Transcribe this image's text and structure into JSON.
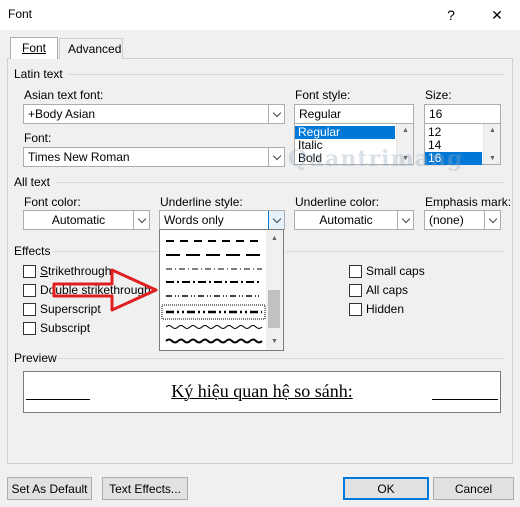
{
  "window": {
    "title": "Font",
    "help": "?",
    "close": "✕"
  },
  "tabs": [
    {
      "label": "Font",
      "active": true
    },
    {
      "label": "Advanced",
      "active": false
    }
  ],
  "latin": {
    "group_label": "Latin text",
    "asian_font_label": "Asian text font:",
    "asian_font_value": "+Body Asian",
    "font_label": "Font:",
    "font_value": "Times New Roman",
    "style_label": "Font style:",
    "style_value": "Regular",
    "style_options": [
      "Regular",
      "Italic",
      "Bold"
    ],
    "style_selected": "Regular",
    "size_label": "Size:",
    "size_value": "16",
    "size_options": [
      "12",
      "14",
      "16"
    ],
    "size_selected": "16"
  },
  "all_text": {
    "group_label": "All text",
    "color_label": "Font color:",
    "color_value": "Automatic",
    "underline_style_label": "Underline style:",
    "underline_style_value": "Words only",
    "underline_color_label": "Underline color:",
    "underline_color_value": "Automatic",
    "emphasis_label": "Emphasis mark:",
    "emphasis_value": "(none)"
  },
  "effects": {
    "group_label": "Effects",
    "left": [
      {
        "label": "Strikethrough",
        "checked": false
      },
      {
        "label": "Double strikethrough",
        "checked": false
      },
      {
        "label": "Superscript",
        "checked": false
      },
      {
        "label": "Subscript",
        "checked": false
      }
    ],
    "right": [
      {
        "label": "Small caps",
        "checked": false
      },
      {
        "label": "All caps",
        "checked": false
      },
      {
        "label": "Hidden",
        "checked": false
      }
    ]
  },
  "preview": {
    "group_label": "Preview",
    "text": "Ký hiệu quan hệ so sánh:"
  },
  "watermark": "Quantrimang",
  "buttons": {
    "set_default": "Set As Default",
    "text_effects": "Text Effects...",
    "ok": "OK",
    "cancel": "Cancel"
  },
  "colors": {
    "accent": "#0078d7",
    "arrow": "#e02020"
  }
}
